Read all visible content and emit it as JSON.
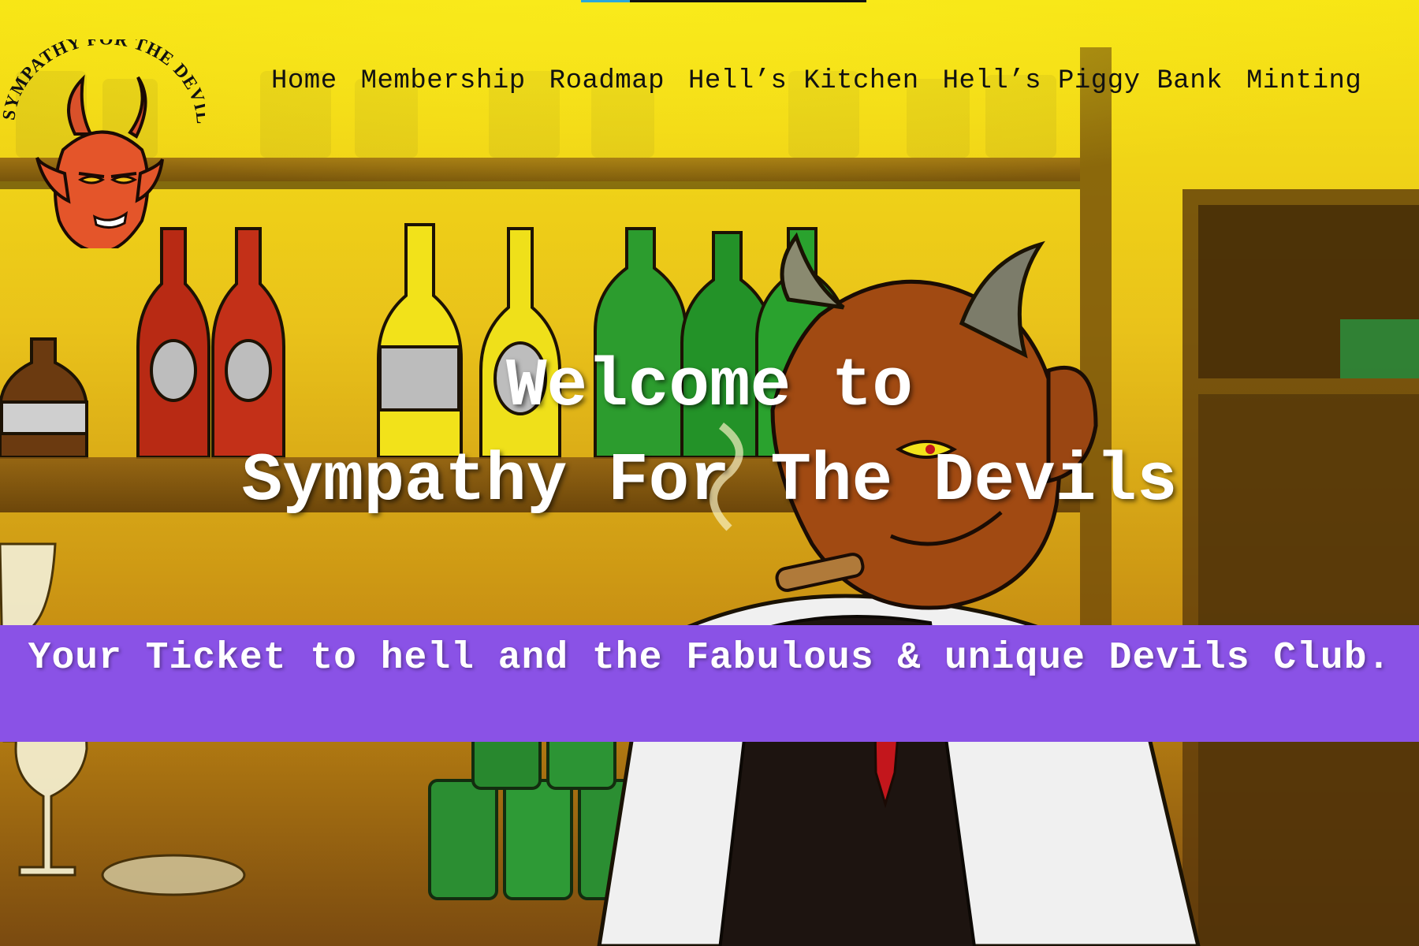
{
  "header": {
    "logo_alt": "SYMPATHY FOR THE DEVILS",
    "nav": [
      {
        "label": "Home"
      },
      {
        "label": "Membership"
      },
      {
        "label": "Roadmap"
      },
      {
        "label": "Hell’s Kitchen"
      },
      {
        "label": "Hell’s Piggy Bank"
      },
      {
        "label": "Minting"
      }
    ]
  },
  "hero": {
    "line1": "Welcome to",
    "line2": "Sympathy For The Devils",
    "tagline": "Your Ticket to hell and the Fabulous & unique Devils Club."
  },
  "top_strip": {
    "progress": 0.17,
    "accent": "#2aa7d9"
  },
  "colors": {
    "background": "#f5e41a",
    "tagline_band": "#8a52e6",
    "hero_text": "#ffffff",
    "nav_text": "#111111"
  },
  "icons": {
    "logo": "devil-head-icon"
  }
}
